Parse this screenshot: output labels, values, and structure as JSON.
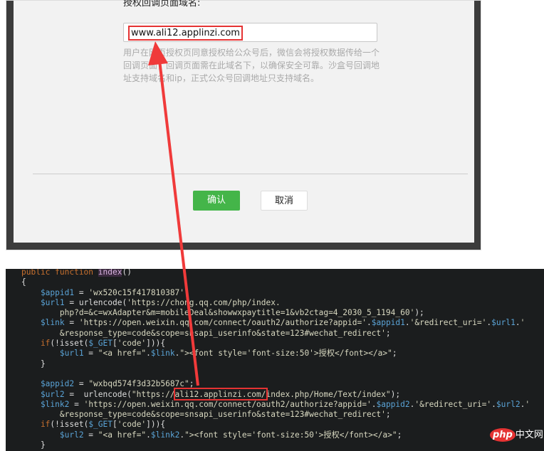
{
  "dialog": {
    "label": "授权回调页面域名:",
    "domain_value": "www.ali12.applinzi.com",
    "hint": "用户在网页授权页同意授权给公众号后，微信会将授权数据传给一个回调页面，回调页面需在此域名下，以确保安全可靠。沙盒号回调地址支持域名和ip，正式公众号回调地址只支持域名。",
    "confirm_label": "确认",
    "cancel_label": "取消"
  },
  "code": [
    [
      [
        "kw",
        "public function "
      ],
      [
        "fn",
        "index"
      ],
      [
        "pl",
        "()"
      ]
    ],
    [
      [
        "pl",
        "{"
      ]
    ],
    [
      [
        "var",
        "    $appid1"
      ],
      [
        "pl",
        " = "
      ],
      [
        "str",
        "'wx520c15f417810387'"
      ],
      [
        "pl",
        ";"
      ]
    ],
    [
      [
        "var",
        "    $url1"
      ],
      [
        "pl",
        " = urlencode("
      ],
      [
        "str",
        "'https://chong.qq.com/php/index."
      ]
    ],
    [
      [
        "str",
        "        php?d=&c=wxAdapter&m=mobileDeal&showwxpaytitle=1&vb2ctag=4_2030_5_1194_60'"
      ],
      [
        "pl",
        ");"
      ]
    ],
    [
      [
        "var",
        "    $link"
      ],
      [
        "pl",
        " = "
      ],
      [
        "str",
        "'https://open.weixin.qq.com/connect/oauth2/authorize?appid='"
      ],
      [
        "pl",
        "."
      ],
      [
        "var",
        "$appid1"
      ],
      [
        "pl",
        "."
      ],
      [
        "str",
        "'&redirect_uri='"
      ],
      [
        "pl",
        "."
      ],
      [
        "var",
        "$url1"
      ],
      [
        "pl",
        "."
      ],
      [
        "str",
        "'"
      ]
    ],
    [
      [
        "str",
        "        &response_type=code&scope=snsapi_userinfo&state=123#wechat_redirect'"
      ],
      [
        "pl",
        ";"
      ]
    ],
    [
      [
        "kw",
        "    if"
      ],
      [
        "pl",
        "(!isset("
      ],
      [
        "var",
        "$_GET"
      ],
      [
        "pl",
        "["
      ],
      [
        "str",
        "'code'"
      ],
      [
        "pl",
        "])){"
      ]
    ],
    [
      [
        "var",
        "        $url1"
      ],
      [
        "pl",
        " = "
      ],
      [
        "str",
        "\"<a href=\""
      ],
      [
        "pl",
        "."
      ],
      [
        "var",
        "$link"
      ],
      [
        "pl",
        "."
      ],
      [
        "str",
        "\"><font style='font-size:50'>授权</font></a>\""
      ],
      [
        "pl",
        ";"
      ]
    ],
    [
      [
        "pl",
        "    }"
      ]
    ],
    [
      [
        "pl",
        ""
      ]
    ],
    [
      [
        "var",
        "    $appid2"
      ],
      [
        "pl",
        " = "
      ],
      [
        "str",
        "\"wxbqd574f3d32b5687c\""
      ],
      [
        "pl",
        ";"
      ]
    ],
    [
      [
        "var",
        "    $url2"
      ],
      [
        "pl",
        " =  urlencode("
      ],
      [
        "str",
        "\"https://ali12.applinzi.com/index.php/Home/Text/index\""
      ],
      [
        "pl",
        ");"
      ]
    ],
    [
      [
        "var",
        "    $link2"
      ],
      [
        "pl",
        " = "
      ],
      [
        "str",
        "'https://open.weixin.qq.com/connect/oauth2/authorize?appid='"
      ],
      [
        "pl",
        "."
      ],
      [
        "var",
        "$appid2"
      ],
      [
        "pl",
        "."
      ],
      [
        "str",
        "'&redirect_uri='"
      ],
      [
        "pl",
        "."
      ],
      [
        "var",
        "$url2"
      ],
      [
        "pl",
        "."
      ],
      [
        "str",
        "'"
      ]
    ],
    [
      [
        "str",
        "        &response_type=code&scope=snsapi_userinfo&state=123#wechat_redirect'"
      ],
      [
        "pl",
        ";"
      ]
    ],
    [
      [
        "kw",
        "    if"
      ],
      [
        "pl",
        "(!isset("
      ],
      [
        "var",
        "$_GET"
      ],
      [
        "pl",
        "["
      ],
      [
        "str",
        "'code'"
      ],
      [
        "pl",
        "])){"
      ]
    ],
    [
      [
        "var",
        "        $url2"
      ],
      [
        "pl",
        " = "
      ],
      [
        "str",
        "\"<a href=\""
      ],
      [
        "pl",
        "."
      ],
      [
        "var",
        "$link2"
      ],
      [
        "pl",
        "."
      ],
      [
        "str",
        "\"><font style='font-size:50'>授权</font></a>\""
      ],
      [
        "pl",
        ";"
      ]
    ],
    [
      [
        "pl",
        "    }"
      ]
    ]
  ],
  "watermark": {
    "php": "php",
    "site": "中文网"
  },
  "colors": {
    "annotation": "#e53333",
    "confirm": "#44b549"
  }
}
